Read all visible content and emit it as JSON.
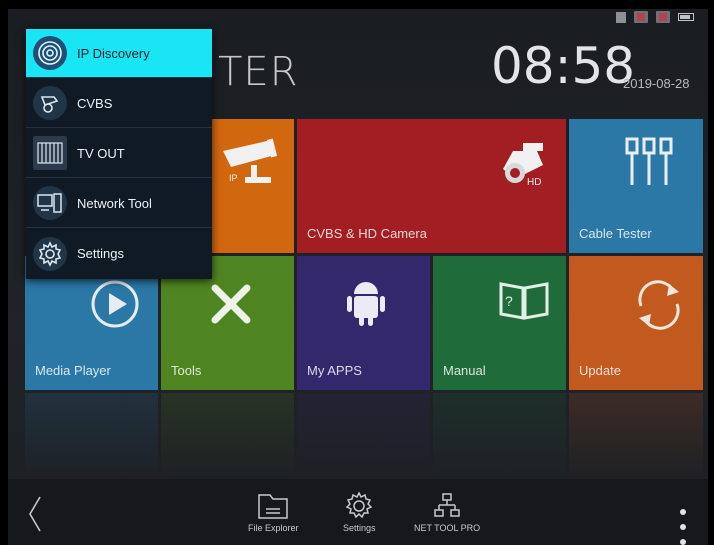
{
  "status_bar": {
    "icons": [
      "sim-icon",
      "sd-card-icon",
      "sd-card-icon",
      "battery-icon"
    ]
  },
  "header": {
    "title": "TER",
    "clock": "08:58",
    "date": "2019-08-28"
  },
  "dropdown_menu": {
    "items": [
      {
        "label": "IP Discovery",
        "icon": "ip-discovery-icon",
        "selected": true
      },
      {
        "label": "CVBS",
        "icon": "cctv-camera-icon",
        "selected": false
      },
      {
        "label": "TV OUT",
        "icon": "tv-out-icon",
        "selected": false
      },
      {
        "label": "Network Tool",
        "icon": "network-tool-icon",
        "selected": false
      },
      {
        "label": "Settings",
        "icon": "settings-gear-icon",
        "selected": false
      }
    ]
  },
  "tiles": {
    "ip_camera": {
      "label": "",
      "color": "#d1670f",
      "icon": "ip-camera-icon",
      "icon_text": "IP"
    },
    "cvbs_hd_camera": {
      "label": "CVBS & HD Camera",
      "color": "#a31e22",
      "icon": "dome-camera-icon",
      "icon_text": "HD"
    },
    "cable_tester": {
      "label": "Cable Tester",
      "color": "#2b78a7",
      "icon": "cable-connector-icon"
    },
    "media_player": {
      "label": "Media Player",
      "color": "#2b78a7",
      "icon": "play-icon"
    },
    "tools": {
      "label": "Tools",
      "color": "#4f8520",
      "icon": "tools-icon"
    },
    "my_apps": {
      "label": "My APPS",
      "color": "#34286d",
      "icon": "android-icon"
    },
    "manual": {
      "label": "Manual",
      "color": "#1f6b3a",
      "icon": "book-icon",
      "icon_text": "?"
    },
    "update": {
      "label": "Update",
      "color": "#c25a20",
      "icon": "refresh-icon"
    }
  },
  "bottom_bar": {
    "items": [
      {
        "label": "File Explorer",
        "icon": "folder-icon"
      },
      {
        "label": "Settings",
        "icon": "gear-icon"
      },
      {
        "label": "NET TOOL PRO",
        "icon": "network-icon"
      }
    ]
  }
}
